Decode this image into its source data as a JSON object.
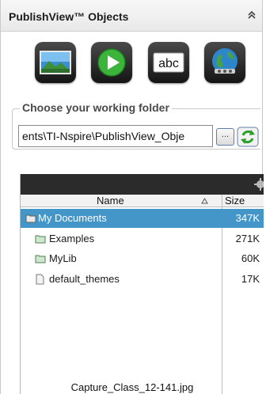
{
  "panel": {
    "title": "PublishView™ Objects"
  },
  "tools": [
    {
      "name": "image-tool",
      "icon": "landscape-image-icon"
    },
    {
      "name": "video-tool",
      "icon": "play-icon"
    },
    {
      "name": "text-tool",
      "icon": "text-abc-icon",
      "label": "abc"
    },
    {
      "name": "web-link-tool",
      "icon": "globe-link-icon"
    }
  ],
  "folder": {
    "label": "Choose your working folder",
    "path": "ents\\TI-Nspire\\PublishView_Obje",
    "browse_label": "...",
    "refresh_icon": "refresh-icon"
  },
  "browser": {
    "columns": {
      "name": "Name",
      "size": "Size"
    },
    "rows": [
      {
        "name": "My Documents",
        "size": "347K",
        "type": "folder",
        "selected": true
      },
      {
        "name": "Examples",
        "size": "271K",
        "type": "folder",
        "selected": false
      },
      {
        "name": "MyLib",
        "size": "60K",
        "type": "folder",
        "selected": false
      },
      {
        "name": "default_themes",
        "size": "17K",
        "type": "file",
        "selected": false
      }
    ],
    "selected_file": "Capture_Class_12-141.jpg"
  },
  "colors": {
    "selection": "#4596c8",
    "header_bar": "#2b2b2b",
    "refresh_green": "#2e9e2e"
  }
}
